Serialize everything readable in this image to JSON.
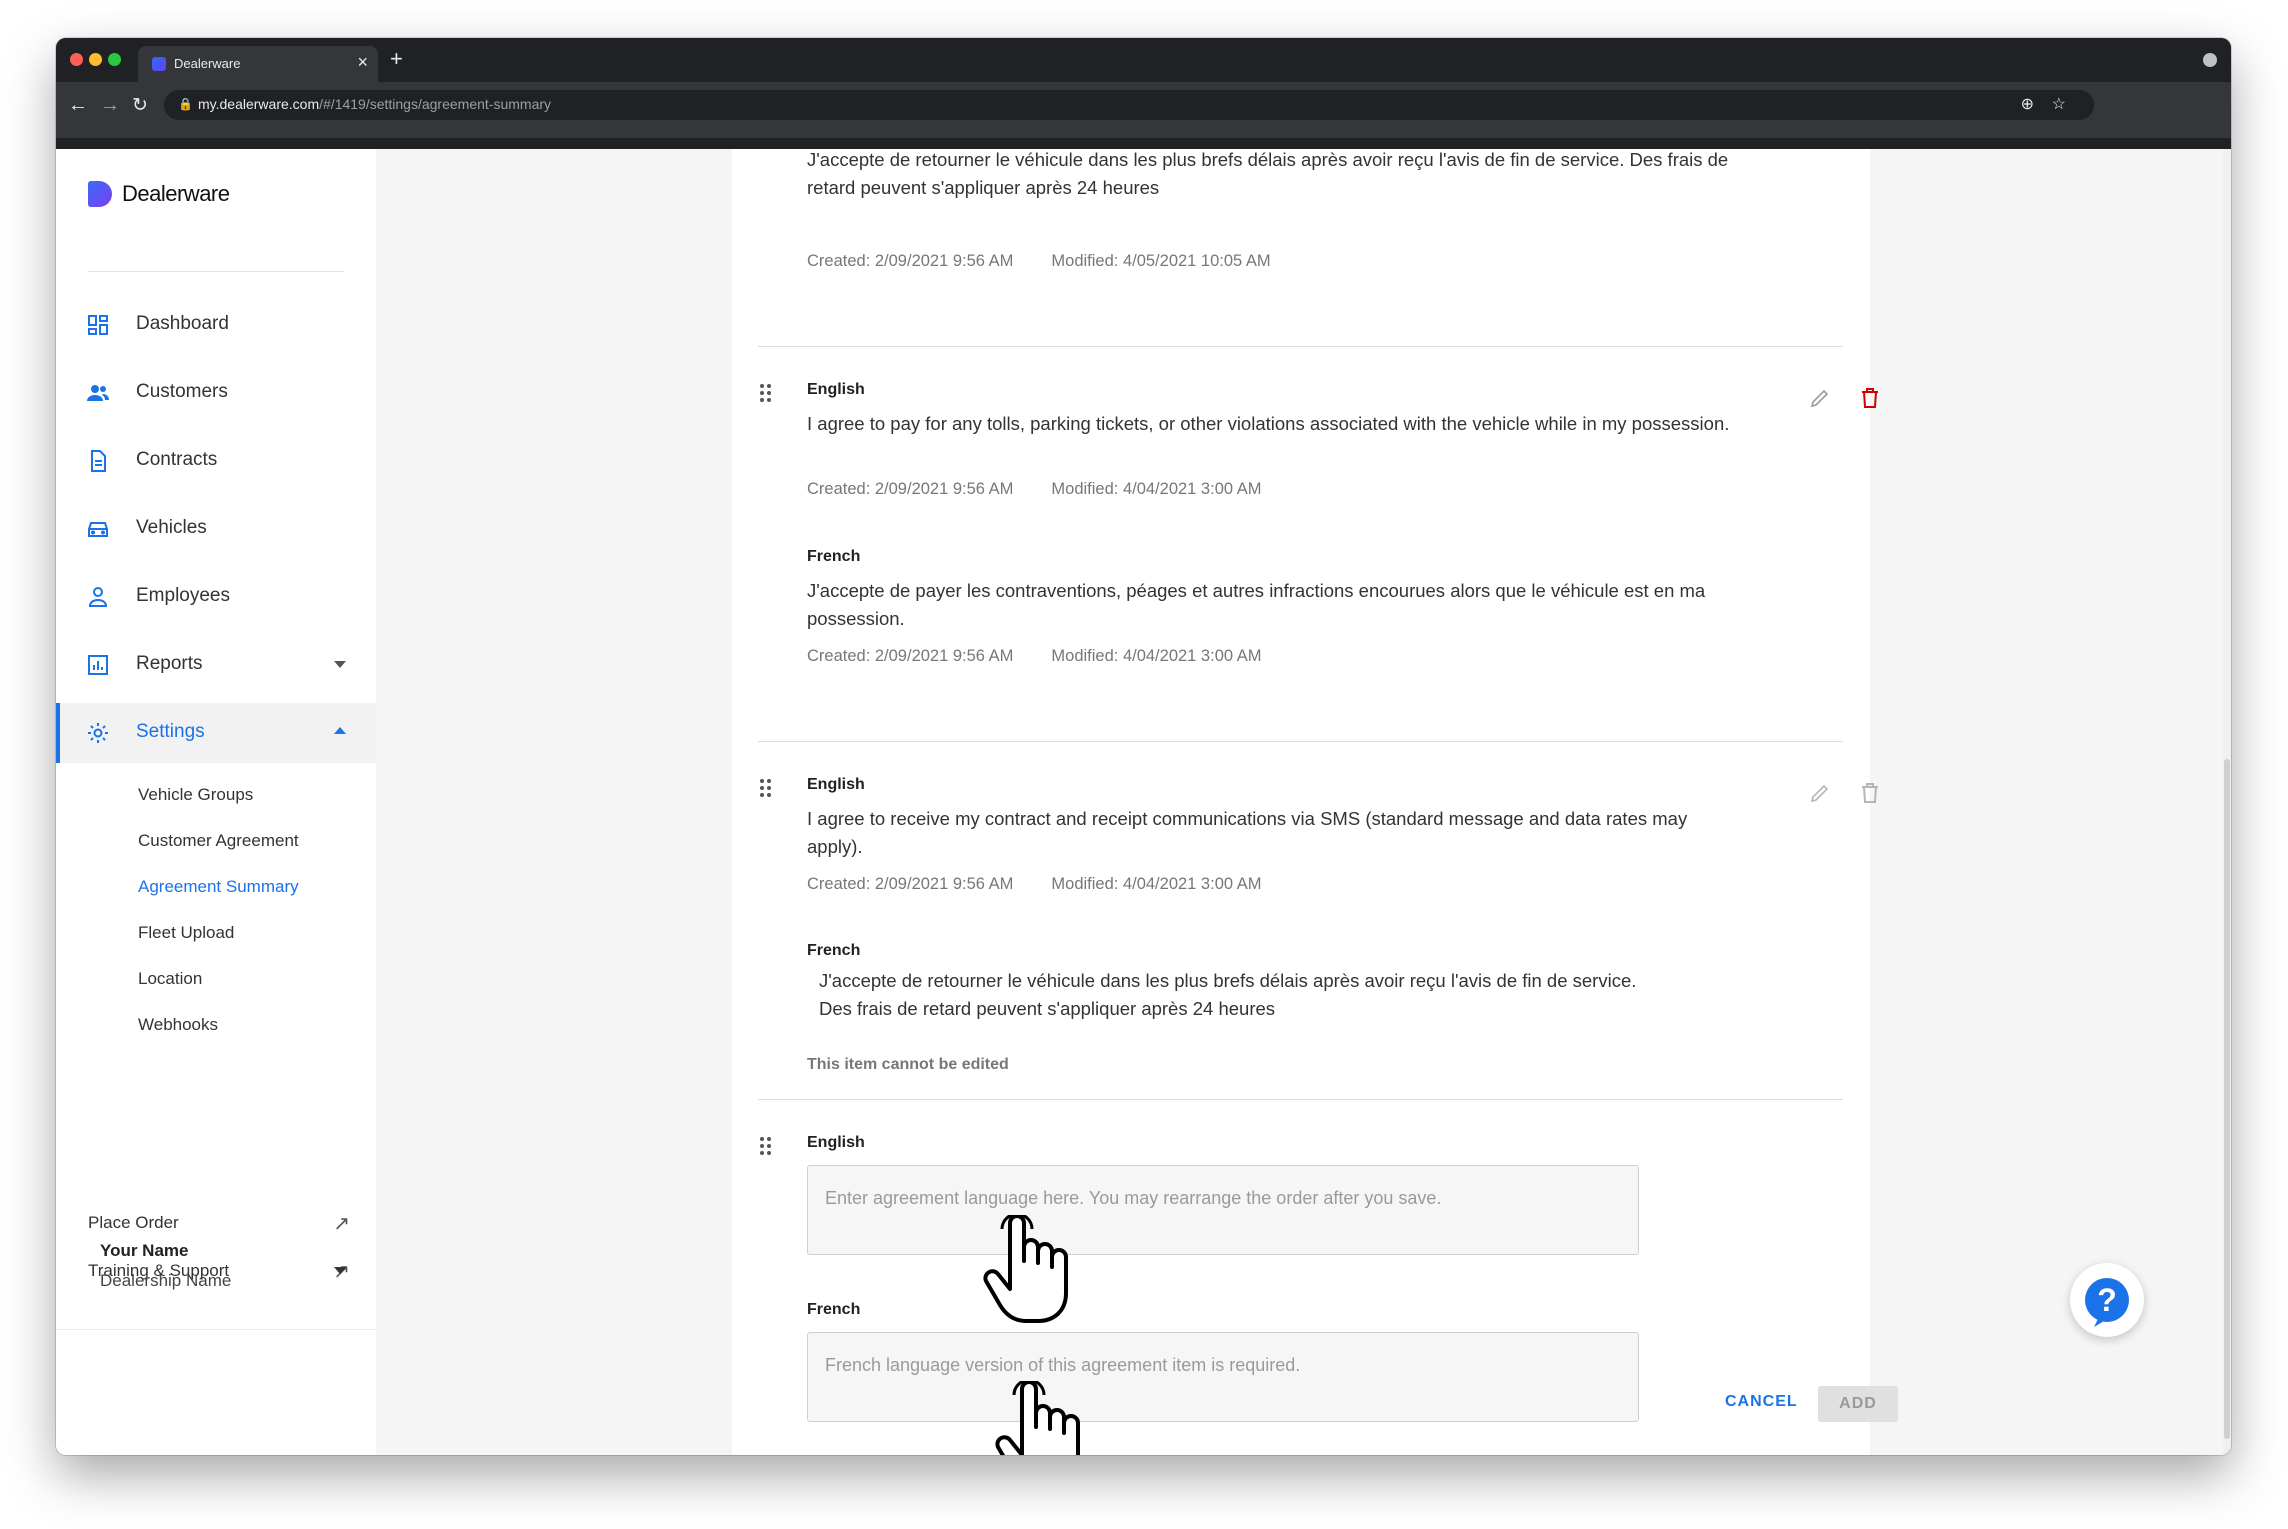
{
  "browser": {
    "tab_title": "Dealerware",
    "url_host": "my.dealerware.com",
    "url_path": "/#/1419/settings/agreement-summary"
  },
  "brand": {
    "name": "Dealerware",
    "accent": "#1a73e8",
    "danger": "#d50000"
  },
  "sidebar": {
    "items": [
      {
        "label": "Dashboard",
        "icon": "dashboard-icon"
      },
      {
        "label": "Customers",
        "icon": "customers-icon"
      },
      {
        "label": "Contracts",
        "icon": "contracts-icon"
      },
      {
        "label": "Vehicles",
        "icon": "vehicle-icon"
      },
      {
        "label": "Employees",
        "icon": "employee-icon"
      },
      {
        "label": "Reports",
        "icon": "reports-icon"
      },
      {
        "label": "Settings",
        "icon": "gear-icon"
      }
    ],
    "settings_sub": [
      "Vehicle Groups",
      "Customer Agreement",
      "Agreement Summary",
      "Fleet Upload",
      "Location",
      "Webhooks"
    ],
    "place_order": "Place Order",
    "training": "Training & Support",
    "user_name": "Your Name",
    "dealership": "Dealership Name"
  },
  "agreement": {
    "top": {
      "french_text": "J'accepte de retourner le véhicule dans les plus brefs délais après avoir reçu l'avis de fin de service. Des frais de retard peuvent s'appliquer après 24 heures",
      "created": "Created: 2/09/2021 9:56 AM",
      "modified": "Modified: 4/05/2021 10:05 AM"
    },
    "item2": {
      "english_label": "English",
      "english_text": "I agree to pay for any tolls, parking tickets, or other violations associated with the vehicle while in my possession.",
      "english_created": "Created: 2/09/2021 9:56 AM",
      "english_modified": "Modified: 4/04/2021 3:00 AM",
      "french_label": "French",
      "french_text": "J'accepte de payer les contraventions, péages et autres infractions encourues alors que le véhicule est en ma possession.",
      "french_created": "Created: 2/09/2021 9:56 AM",
      "french_modified": "Modified: 4/04/2021 3:00 AM"
    },
    "item3": {
      "english_label": "English",
      "english_text": "I agree to receive my contract and receipt communications via SMS (standard message and data rates may apply).",
      "english_created": "Created: 2/09/2021 9:56 AM",
      "english_modified": "Modified: 4/04/2021 3:00 AM",
      "french_label": "French",
      "french_line1": "J'accepte de retourner le véhicule dans les plus brefs délais après avoir reçu l'avis de fin de service.",
      "french_line2": "Des frais de retard peuvent s'appliquer après 24 heures",
      "note": "This item cannot be edited"
    },
    "new_item": {
      "english_label": "English",
      "english_placeholder": "Enter agreement language here. You may rearrange the order after you save.",
      "french_label": "French",
      "french_placeholder": "French language version of this agreement item is required.",
      "cancel": "CANCEL",
      "add": "ADD"
    }
  }
}
